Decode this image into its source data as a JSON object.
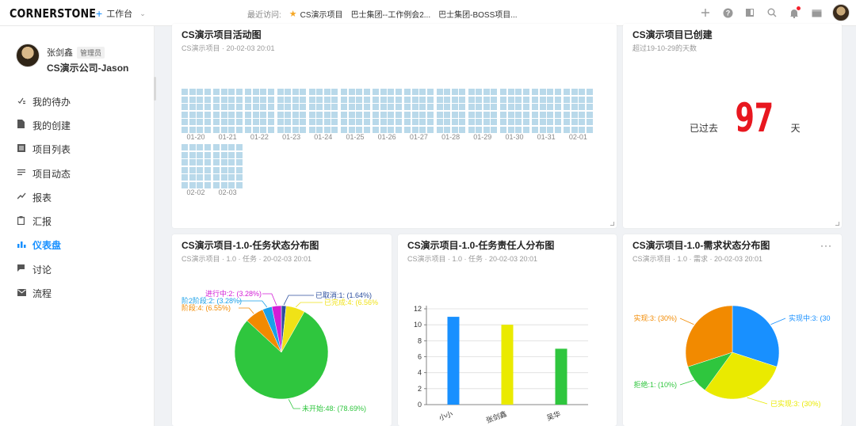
{
  "header": {
    "logo": "CORNERSTONE",
    "workbench_label": "工作台",
    "recent_label": "最近访问:",
    "recent_items": [
      "CS演示项目",
      "巴士集团--工作例会2...",
      "巴士集团-BOSS项目..."
    ]
  },
  "user": {
    "name": "张剑鑫",
    "role": "管理员",
    "company": "CS演示公司-Jason"
  },
  "nav": [
    {
      "label": "我的待办",
      "icon": "todo-check-icon"
    },
    {
      "label": "我的创建",
      "icon": "file-icon"
    },
    {
      "label": "项目列表",
      "icon": "list-icon"
    },
    {
      "label": "项目动态",
      "icon": "lines-icon"
    },
    {
      "label": "报表",
      "icon": "trend-icon"
    },
    {
      "label": "汇报",
      "icon": "clipboard-icon"
    },
    {
      "label": "仪表盘",
      "icon": "bar-chart-icon",
      "active": true
    },
    {
      "label": "讨论",
      "icon": "chat-icon"
    },
    {
      "label": "流程",
      "icon": "mail-icon"
    }
  ],
  "cards": {
    "activity": {
      "title": "CS演示项目活动图",
      "subtitle": "CS演示项目 · 20-02-03 20:01",
      "days": [
        "01-20",
        "01-21",
        "01-22",
        "01-23",
        "01-24",
        "01-25",
        "01-26",
        "01-27",
        "01-28",
        "01-29",
        "01-30",
        "01-31",
        "02-01",
        "02-02",
        "02-03"
      ]
    },
    "created": {
      "title": "CS演示项目已创建",
      "subtitle": "超过19-10-29的天数",
      "prefix": "已过去",
      "days": "97",
      "suffix": "天"
    },
    "task_status": {
      "title": "CS演示项目-1.0-任务状态分布图",
      "subtitle": "CS演示项目 · 1.0 · 任务 · 20-02-03 20:01"
    },
    "task_owner": {
      "title": "CS演示项目-1.0-任务责任人分布图",
      "subtitle": "CS演示项目 · 1.0 · 任务 · 20-02-03 20:01"
    },
    "req_status": {
      "title": "CS演示项目-1.0-需求状态分布图",
      "subtitle": "CS演示项目 · 1.0 · 需求 · 20-02-03 20:01",
      "more": "···"
    }
  },
  "chart_data": [
    {
      "type": "pie",
      "labels": [
        "未开始",
        "阶段",
        "阶段",
        "进行中",
        "已取消",
        "已完成"
      ],
      "values": [
        48,
        4,
        2,
        2,
        1,
        4
      ],
      "display_labels": [
        "未开始:48: (78.69%)",
        "阶段:4: (6.55%)",
        "阶2阶段:2: (3.28%)",
        "进行中:2: (3.28%)",
        "已取消:1: (1.64%)",
        "已完成:4: (6.56%"
      ],
      "colors": [
        "#2fc63e",
        "#f28a00",
        "#1aa0e8",
        "#d21cd6",
        "#2c4f9e",
        "#f0e217"
      ]
    },
    {
      "type": "bar",
      "categories": [
        "小小",
        "张剑鑫",
        "吴华"
      ],
      "values": [
        11,
        10,
        7
      ],
      "colors": [
        "#1890ff",
        "#eaea00",
        "#2fc63e"
      ],
      "ylim": [
        0,
        12
      ],
      "yticks": [
        0,
        2,
        4,
        6,
        8,
        10,
        12
      ],
      "grid": true
    },
    {
      "type": "pie",
      "labels": [
        "实现中",
        "已实现",
        "拒绝",
        "实现"
      ],
      "values": [
        3,
        3,
        1,
        3
      ],
      "display_labels": [
        "实现中:3: (30",
        "已实现:3: (30%)",
        "拒绝:1: (10%)",
        "实现:3: (30%)"
      ],
      "colors": [
        "#1890ff",
        "#eaea00",
        "#2fc63e",
        "#f28a00"
      ]
    }
  ]
}
